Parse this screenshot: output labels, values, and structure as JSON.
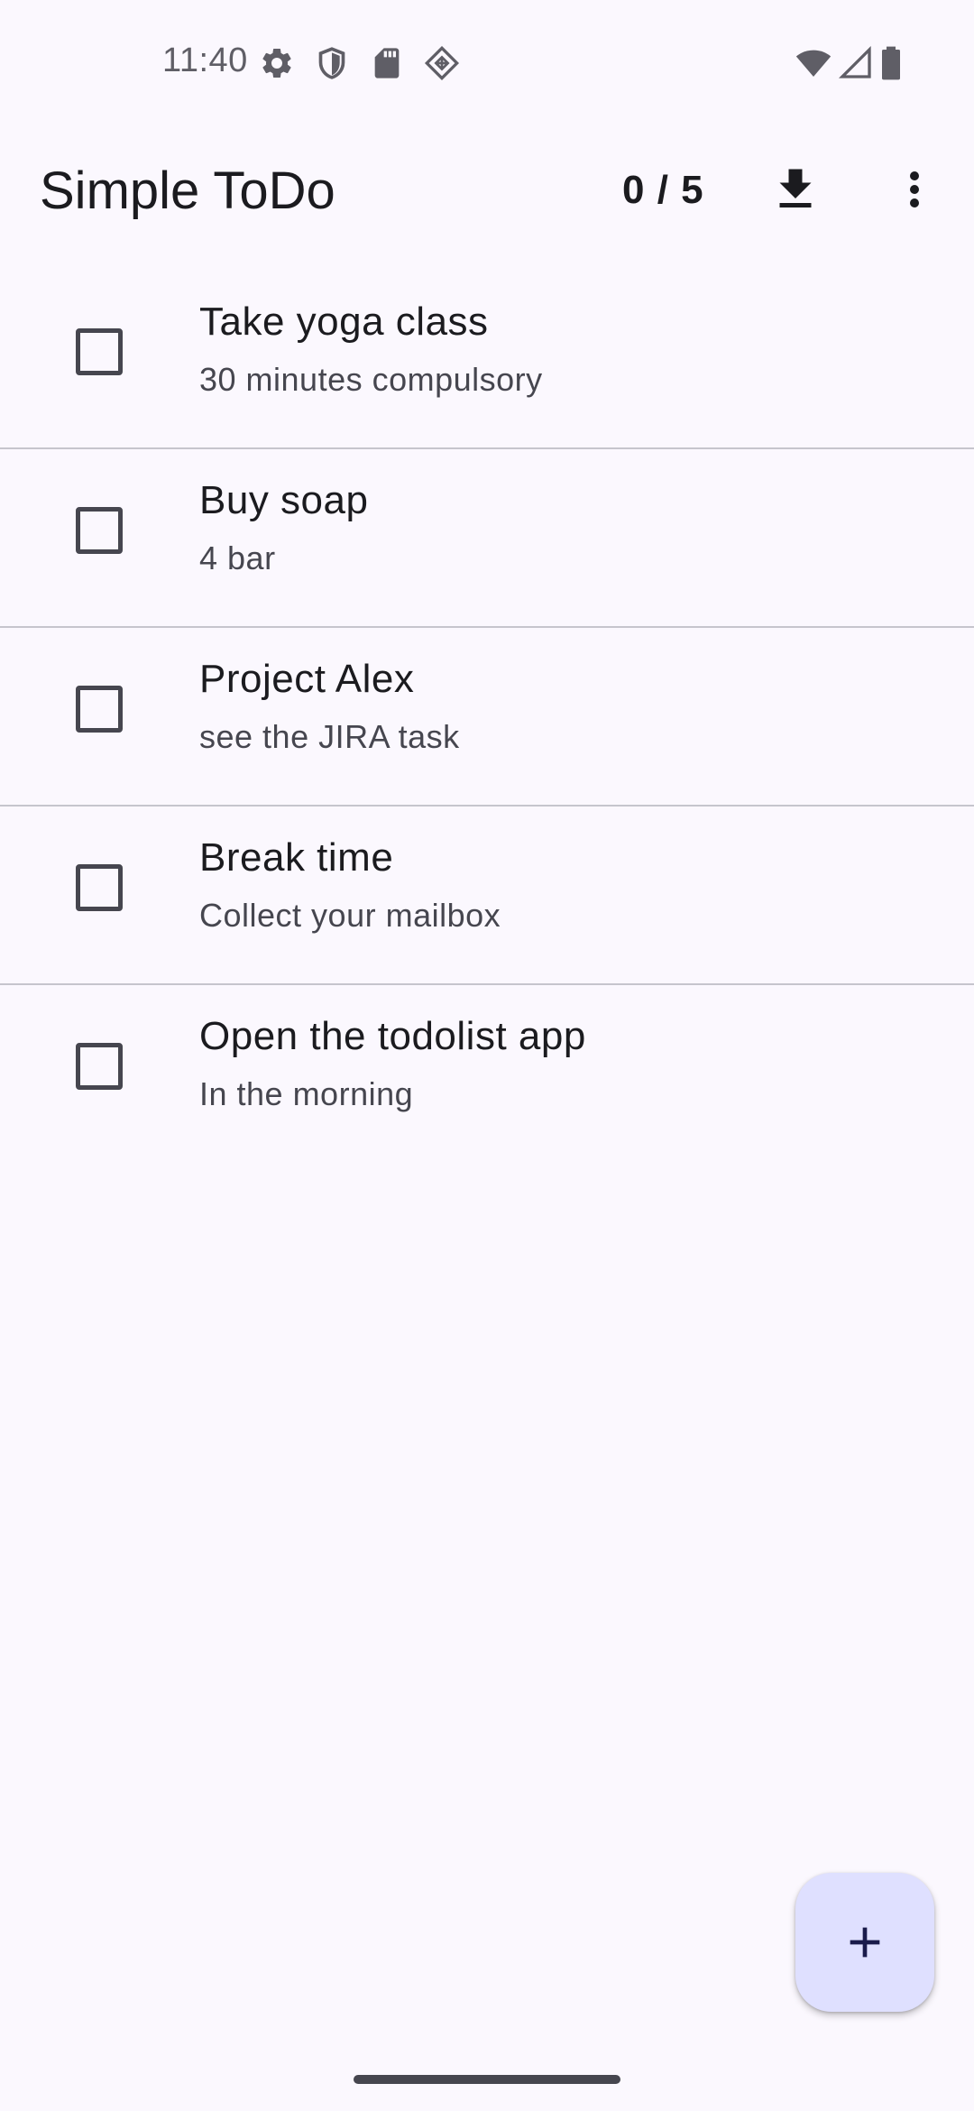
{
  "status_bar": {
    "time": "11:40",
    "left_icons": [
      "settings-icon",
      "shield-icon",
      "sd-card-icon",
      "cast-icon"
    ],
    "right_icons": [
      "wifi-icon",
      "cell-signal-icon",
      "battery-icon"
    ]
  },
  "app_bar": {
    "title": "Simple ToDo",
    "counter": "0 / 5",
    "actions": [
      "download-icon",
      "more-vert-icon"
    ]
  },
  "todos": [
    {
      "title": "Take yoga class",
      "subtitle": "30 minutes compulsory",
      "checked": false
    },
    {
      "title": "Buy soap",
      "subtitle": "4 bar",
      "checked": false
    },
    {
      "title": "Project Alex",
      "subtitle": "see the JIRA task",
      "checked": false
    },
    {
      "title": "Break time",
      "subtitle": "Collect your mailbox",
      "checked": false
    },
    {
      "title": "Open the todolist app",
      "subtitle": "In the morning",
      "checked": false
    }
  ],
  "fab": {
    "icon": "add-icon"
  },
  "colors": {
    "background": "#FBF8FE",
    "fab_background": "#DFE0FF",
    "divider": "#C6C5CD",
    "text_primary": "#1B1B1F",
    "text_secondary": "#46464F"
  }
}
